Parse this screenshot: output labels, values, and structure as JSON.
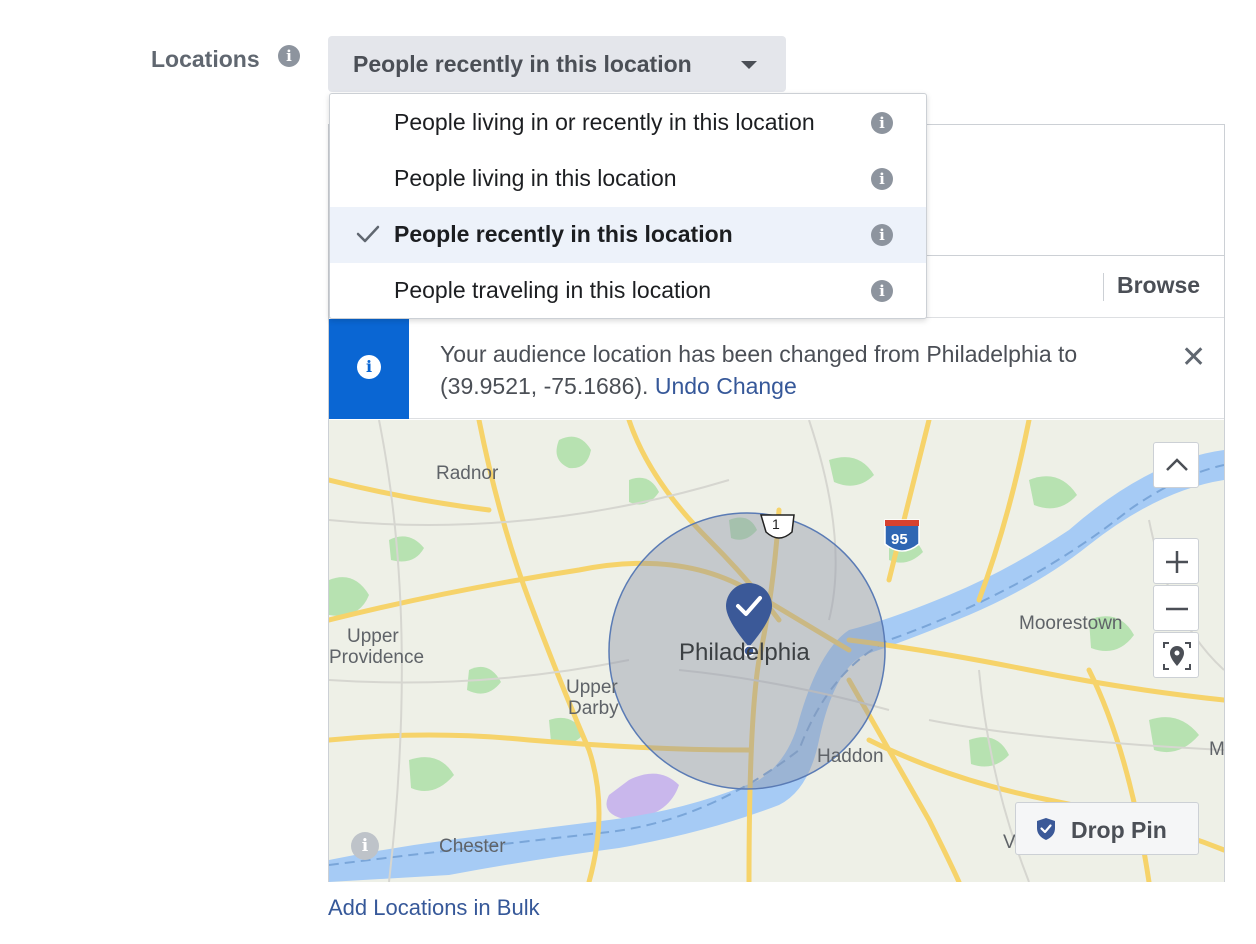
{
  "locations": {
    "label": "Locations",
    "selected_type": "People recently in this location"
  },
  "dropdown": {
    "options": [
      {
        "label": "People living in or recently in this location",
        "selected": false
      },
      {
        "label": "People living in this location",
        "selected": false
      },
      {
        "label": "People recently in this location",
        "selected": true
      },
      {
        "label": "People traveling in this location",
        "selected": false
      }
    ]
  },
  "search": {
    "browse_label": "Browse"
  },
  "notice": {
    "line1": "Your audience location has been changed from Philadelphia to",
    "line2": "(39.9521, -75.1686).",
    "undo_label": "Undo Change",
    "close_symbol": "✕"
  },
  "map": {
    "labels": {
      "radnor": "Radnor",
      "upper_providence_1": "Upper",
      "upper_providence_2": "Providence",
      "upper_darby_1": "Upper",
      "upper_darby_2": "Darby",
      "philadelphia": "Philadelphia",
      "moorestown": "Moorestown",
      "haddon": "Haddon",
      "chester": "Chester",
      "edge_m": "M",
      "edge_v": "V",
      "route_1": "1",
      "interstate_95": "95"
    },
    "drop_pin_label": "Drop Pin",
    "colors": {
      "water": "#a6cbf5",
      "park": "#a8dba8",
      "highway": "#f9d866",
      "radius_fill": "#8c93a8",
      "pin": "#3b5998"
    }
  },
  "footer": {
    "bulk_label": "Add Locations in Bulk"
  },
  "icons": [
    "info-icon",
    "caret-down-icon",
    "check-icon",
    "close-icon",
    "chevron-up-icon",
    "plus-icon",
    "minus-icon",
    "locate-icon",
    "shield-check-icon",
    "map-pin-icon"
  ]
}
